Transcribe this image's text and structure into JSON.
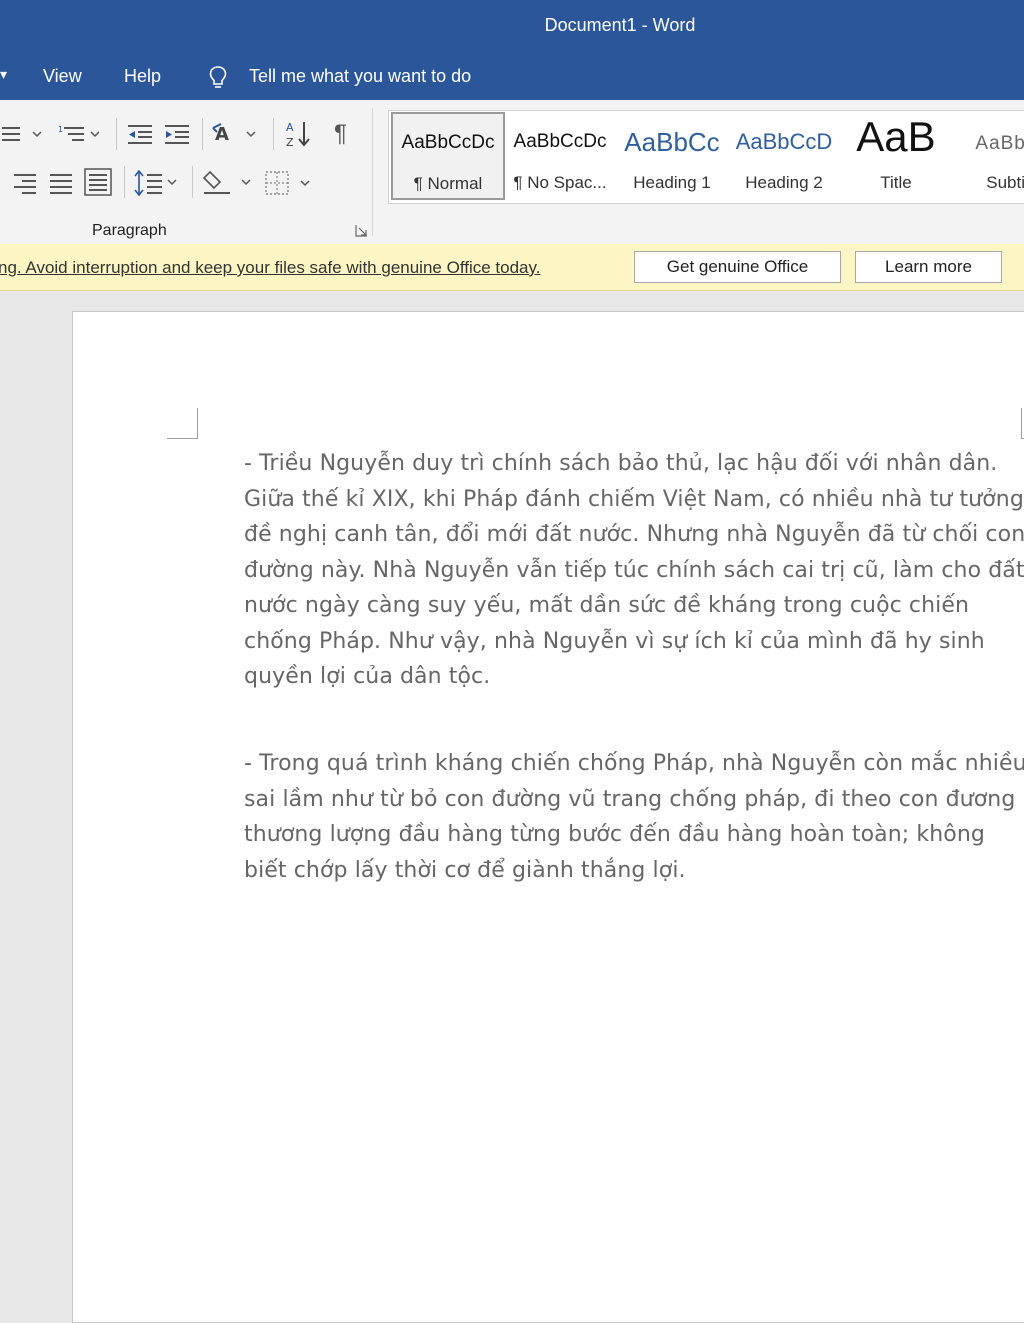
{
  "window": {
    "title": "Document1  -  Word"
  },
  "menu": {
    "tabs": [
      "View",
      "Help"
    ],
    "tell_me": "Tell me what you want to do"
  },
  "ribbon": {
    "paragraph_group_label": "Paragraph",
    "styles": [
      {
        "preview": "AaBbCcDc",
        "name": "¶ Normal",
        "selected": true
      },
      {
        "preview": "AaBbCcDc",
        "name": "¶ No Spac..."
      },
      {
        "preview": "AaBbCc",
        "name": "Heading 1"
      },
      {
        "preview": "AaBbCcD",
        "name": "Heading 2"
      },
      {
        "preview": "AaB",
        "name": "Title"
      },
      {
        "preview": "AaBbC",
        "name": "Subtit"
      }
    ]
  },
  "notice": {
    "message": "ng. Avoid interruption and keep your files safe with genuine Office today.",
    "get_genuine": "Get genuine Office",
    "learn_more": "Learn more"
  },
  "document": {
    "paragraphs": [
      "- Triều Nguyễn duy trì chính sách bảo thủ, lạc hậu đối với nhân dân. Giữa thế kỉ XIX, khi Pháp đánh chiếm Việt Nam, có nhiều nhà tư tưởng đề nghị canh tân, đổi mới đất nước. Nhưng nhà Nguyễn đã từ chối con đường này. Nhà Nguyễn vẫn tiếp túc chính sách cai trị cũ, làm cho đất nước ngày càng suy yếu, mất dần sức đề kháng trong cuộc chiến chống Pháp. Như vậy, nhà Nguyễn vì sự ích kỉ của mình đã hy sinh quyền lợi của dân tộc.",
      "- Trong quá trình kháng chiến chống Pháp, nhà Nguyễn còn mắc nhiều sai lầm như từ bỏ con đường vũ trang chống pháp, đi theo con đương thương lượng đầu hàng từng bước đến đầu hàng hoàn toàn; không biết chớp lấy thời cơ để giành thắng lợi."
    ]
  }
}
